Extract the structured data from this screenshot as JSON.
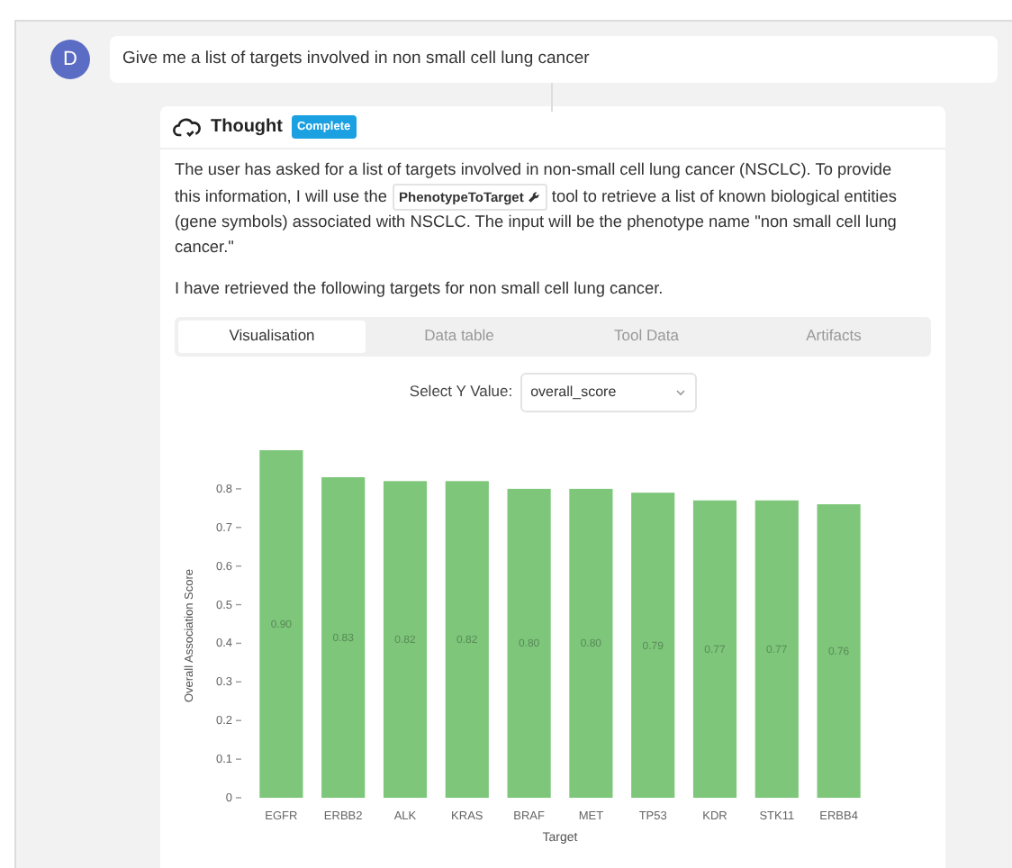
{
  "user_message": {
    "avatar": "D",
    "text": "Give me a list of targets involved in non small cell lung cancer"
  },
  "thought": {
    "title": "Thought",
    "status": "Complete",
    "paragraph": {
      "before": "The user has asked for a list of targets involved in non-small cell lung cancer (NSCLC). To provide this information, I will use the",
      "tool": "PhenotypeToTarget",
      "after": "tool to retrieve a list of known biological entities (gene symbols) associated with NSCLC. The input will be the phenotype name \"non small cell lung cancer.\""
    },
    "result": "I have retrieved the following targets for non small cell lung cancer.",
    "tabs": [
      {
        "label": "Visualisation",
        "selected": true
      },
      {
        "label": "Data table",
        "selected": false
      },
      {
        "label": "Tool Data",
        "selected": false
      },
      {
        "label": "Artifacts",
        "selected": false
      }
    ],
    "select": {
      "label": "Select Y Value:",
      "value": "overall_score"
    },
    "chart_data": {
      "type": "bar",
      "xlabel": "Target",
      "ylabel": "Overall Association Score",
      "categories": [
        "EGFR",
        "ERBB2",
        "ALK",
        "KRAS",
        "BRAF",
        "MET",
        "TP53",
        "KDR",
        "STK11",
        "ERBB4"
      ],
      "ylim": [
        0,
        0.9
      ],
      "series": [
        {
          "color": "#7dc67a",
          "values": [
            0.9,
            0.83,
            0.82,
            0.82,
            0.8,
            0.8,
            0.79,
            0.77,
            0.77,
            0.76
          ]
        }
      ],
      "value_labels": [
        "0.90",
        "0.83",
        "0.82",
        "0.82",
        "0.80",
        "0.80",
        "0.79",
        "0.77",
        "0.77",
        "0.76"
      ],
      "yticks": [
        {
          "value": 0,
          "label": "0"
        },
        0.1,
        0.2,
        0.3,
        0.4,
        0.5,
        0.6,
        0.7,
        0.8
      ]
    }
  }
}
